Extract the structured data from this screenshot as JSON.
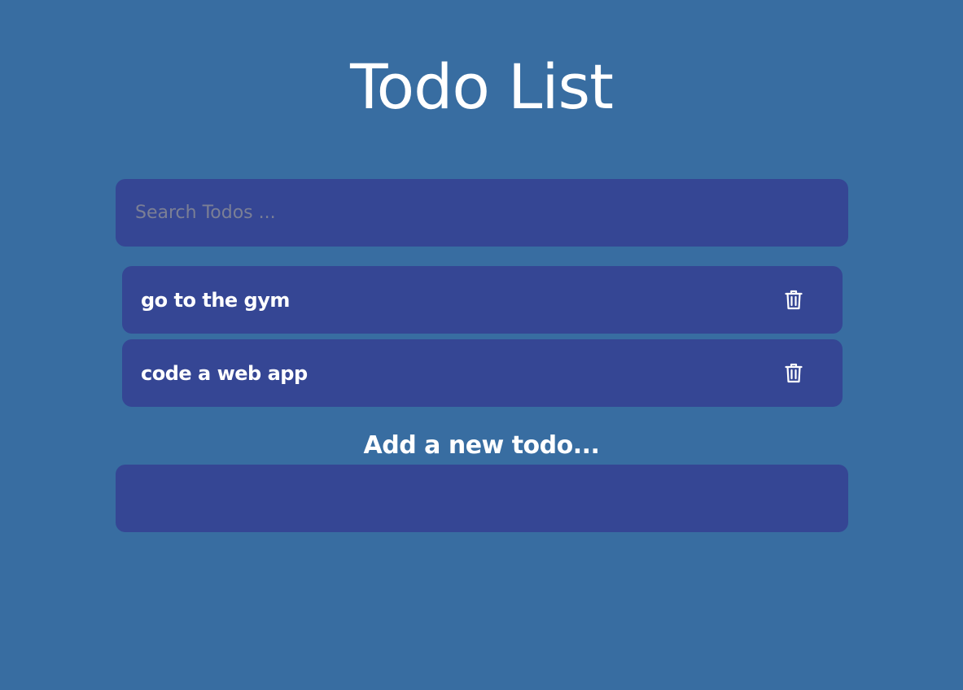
{
  "header": {
    "title": "Todo List"
  },
  "search": {
    "placeholder": "Search Todos ...",
    "value": ""
  },
  "todos": [
    {
      "text": "go to the gym",
      "icon": "trash-icon"
    },
    {
      "text": "code a web app",
      "icon": "trash-icon"
    }
  ],
  "add_form": {
    "label": "Add a new todo...",
    "value": ""
  },
  "colors": {
    "background": "#386da1",
    "panel": "#354694",
    "text": "#ffffff",
    "placeholder": "#7b7f95"
  }
}
